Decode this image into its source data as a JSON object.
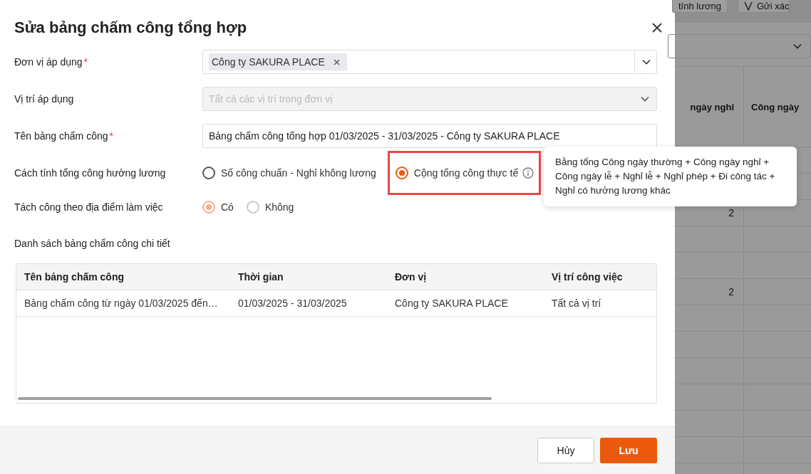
{
  "background_page": {
    "toolbar_buttons": [
      "tính lương",
      "Gửi xác"
    ],
    "table": {
      "columns": [
        "ngày nghỉ",
        "Công ngày"
      ],
      "rows": [
        [
          "",
          ""
        ],
        [
          "",
          ""
        ],
        [
          "2",
          ""
        ],
        [
          "",
          ""
        ],
        [
          "",
          ""
        ],
        [
          "2",
          ""
        ],
        [
          "",
          ""
        ],
        [
          "",
          ""
        ],
        [
          "",
          ""
        ],
        [
          "",
          ""
        ],
        [
          "",
          ""
        ],
        [
          "",
          ""
        ],
        [
          "",
          ""
        ]
      ]
    }
  },
  "dialog": {
    "title": "Sửa bảng chấm công tổng hợp",
    "fields": [
      {
        "kind": "tags",
        "label": "Đơn vị áp dụng",
        "required_mark": "*",
        "tags": [
          "Công ty SAKURA PLACE"
        ],
        "disabled": false
      },
      {
        "kind": "select",
        "label": "Vị trí áp dụng",
        "placeholder": "Tất cả các vị trí trong đơn vị",
        "disabled": true
      },
      {
        "kind": "text",
        "label": "Tên bảng chấm công",
        "required_mark": "*",
        "value": "Bảng chấm công tổng hợp 01/03/2025 - 31/03/2025 - Công ty SAKURA PLACE",
        "disabled": false
      },
      {
        "kind": "radio",
        "label": "Cách tính tổng công hưởng lương",
        "disabled": false,
        "options": [
          {
            "label": "Số công chuẩn - Nghỉ không lương",
            "selected": false,
            "info": false,
            "highlighted": false
          },
          {
            "label": "Cộng tổng công thực tế",
            "selected": true,
            "info": true,
            "highlighted": true
          }
        ]
      },
      {
        "kind": "radio",
        "label": "Tách công theo địa điểm làm việc",
        "disabled": true,
        "options": [
          {
            "label": "Có",
            "selected": true,
            "info": false,
            "highlighted": false
          },
          {
            "label": "Không",
            "selected": false,
            "info": false,
            "highlighted": false
          }
        ]
      }
    ],
    "section_title": "Danh sách bảng chấm công chi tiết",
    "table": {
      "columns": [
        "Tên bảng chấm công",
        "Thời gian",
        "Đơn vị",
        "Vị trí công việc"
      ],
      "rows": [
        [
          "Bảng chấm công từ ngày 01/03/2025 đến…",
          "01/03/2025 - 31/03/2025",
          "Công ty SAKURA PLACE",
          "Tất cả vị trí"
        ]
      ]
    },
    "buttons": [
      {
        "label": "Hủy",
        "kind": "secondary"
      },
      {
        "label": "Lưu",
        "kind": "primary"
      }
    ]
  },
  "tooltip": {
    "lines": [
      "Bằng tổng Công ngày thường + Công ngày nghỉ +",
      "Công ngày lễ + Nghỉ lễ + Nghỉ phép + Đi công tác +",
      "Nghỉ có hưởng lương khác"
    ]
  }
}
